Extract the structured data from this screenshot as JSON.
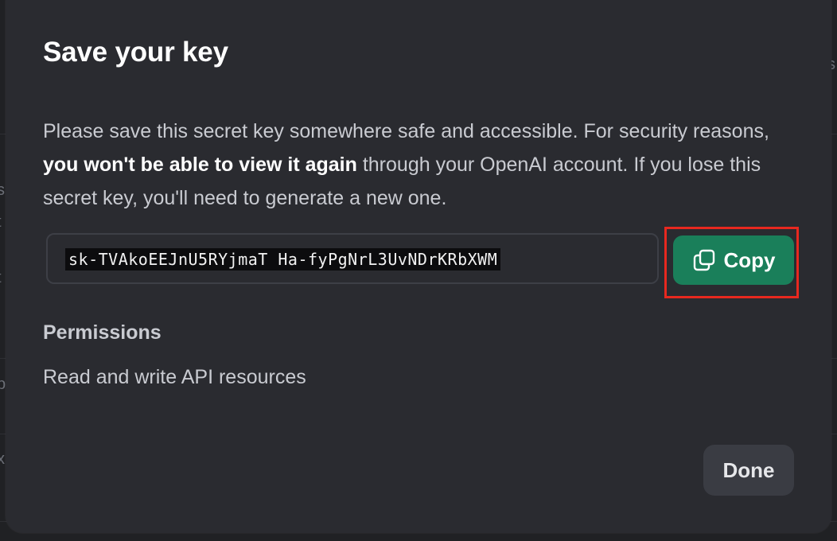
{
  "background": {
    "fragments": [
      "s",
      "s",
      "t",
      "t",
      "p",
      "x"
    ]
  },
  "modal": {
    "title": "Save your key",
    "description": {
      "part1": "Please save this secret key somewhere safe and accessible. For security reasons, ",
      "bold": "you won't be able to view it again",
      "part2": " through your OpenAI account. If you lose this secret key, you'll need to generate a new one."
    },
    "secret_key": "sk-TVAkoEEJnU5RYjmaT Ha-fyPgNrL3UvNDrKRbXWM",
    "copy_label": "Copy",
    "copy_icon": "copy-icon",
    "permissions_heading": "Permissions",
    "permissions_value": "Read and write API resources",
    "done_label": "Done"
  },
  "colors": {
    "modal_bg": "#2a2b30",
    "copy_button": "#1a7f5a",
    "highlight": "#e8281f",
    "done_button": "#3a3c43"
  }
}
